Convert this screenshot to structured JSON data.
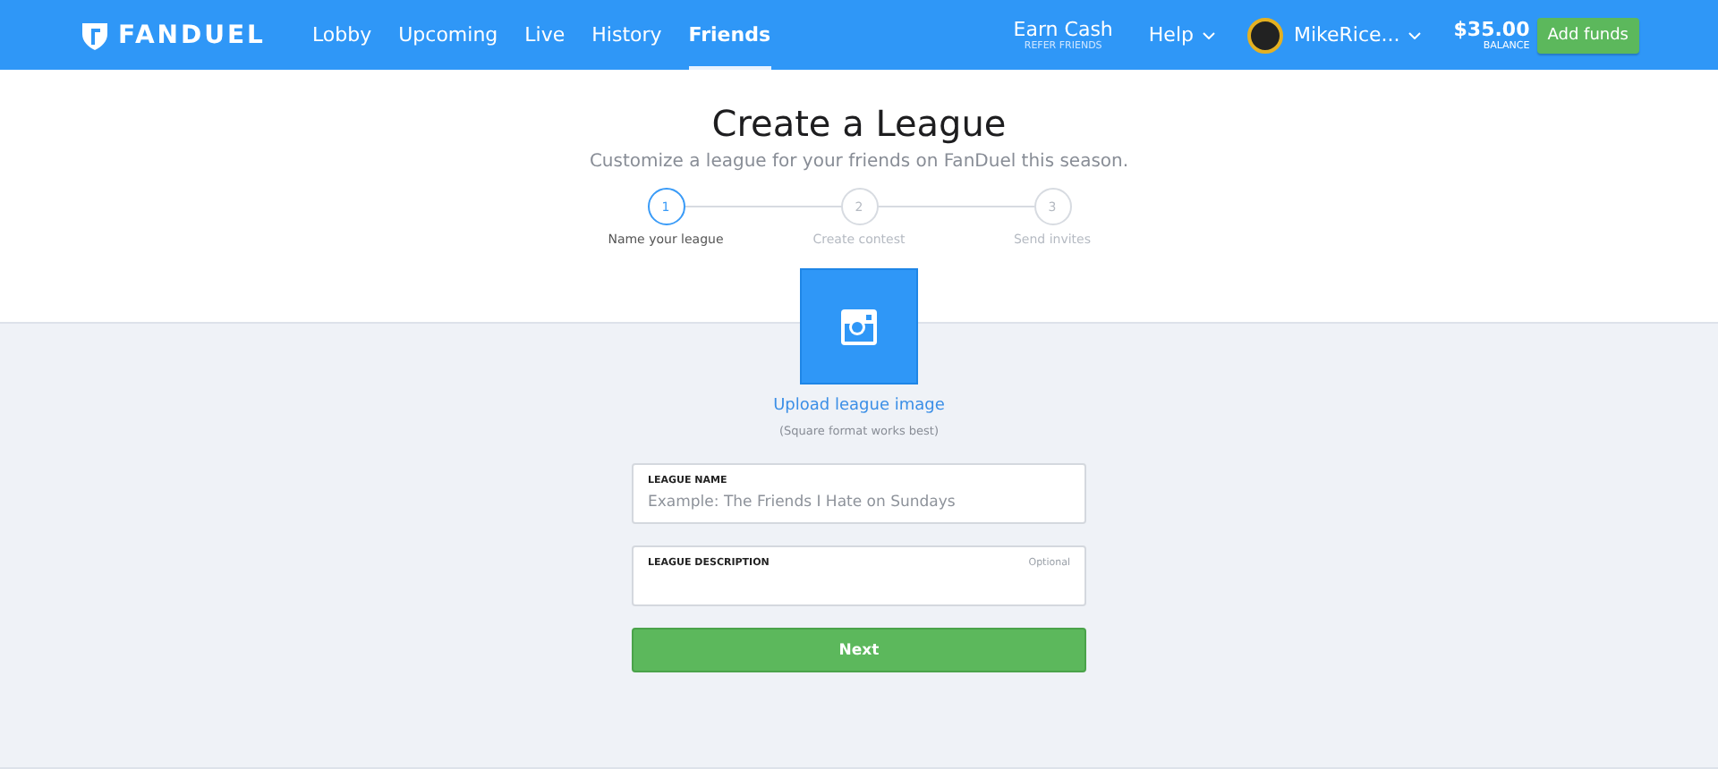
{
  "nav": {
    "logo": "FANDUEL",
    "links": [
      {
        "label": "Lobby",
        "selected": false
      },
      {
        "label": "Upcoming",
        "selected": false
      },
      {
        "label": "Live",
        "selected": false
      },
      {
        "label": "History",
        "selected": false
      },
      {
        "label": "Friends",
        "selected": true
      }
    ],
    "earn": {
      "label": "Earn Cash",
      "sublabel": "REFER FRIENDS"
    },
    "help": "Help",
    "user": "MikeRice...",
    "balance": {
      "amount": "$35.00",
      "label": "BALANCE"
    },
    "add_funds": "Add funds"
  },
  "title": "Create a League",
  "subtitle": "Customize a league for your friends on FanDuel this season.",
  "steps": [
    {
      "number": "1",
      "label": "Name your league",
      "selected": true
    },
    {
      "number": "2",
      "label": "Create contest",
      "selected": false
    },
    {
      "number": "3",
      "label": "Send invites",
      "selected": false
    }
  ],
  "upload": {
    "link": "Upload league image",
    "hint": "(Square format works best)"
  },
  "fields": [
    {
      "label": "LEAGUE NAME",
      "placeholder": "Example: The Friends I Hate on Sundays"
    },
    {
      "label": "LEAGUE DESCRIPTION",
      "note": "Optional"
    }
  ],
  "next": "Next"
}
